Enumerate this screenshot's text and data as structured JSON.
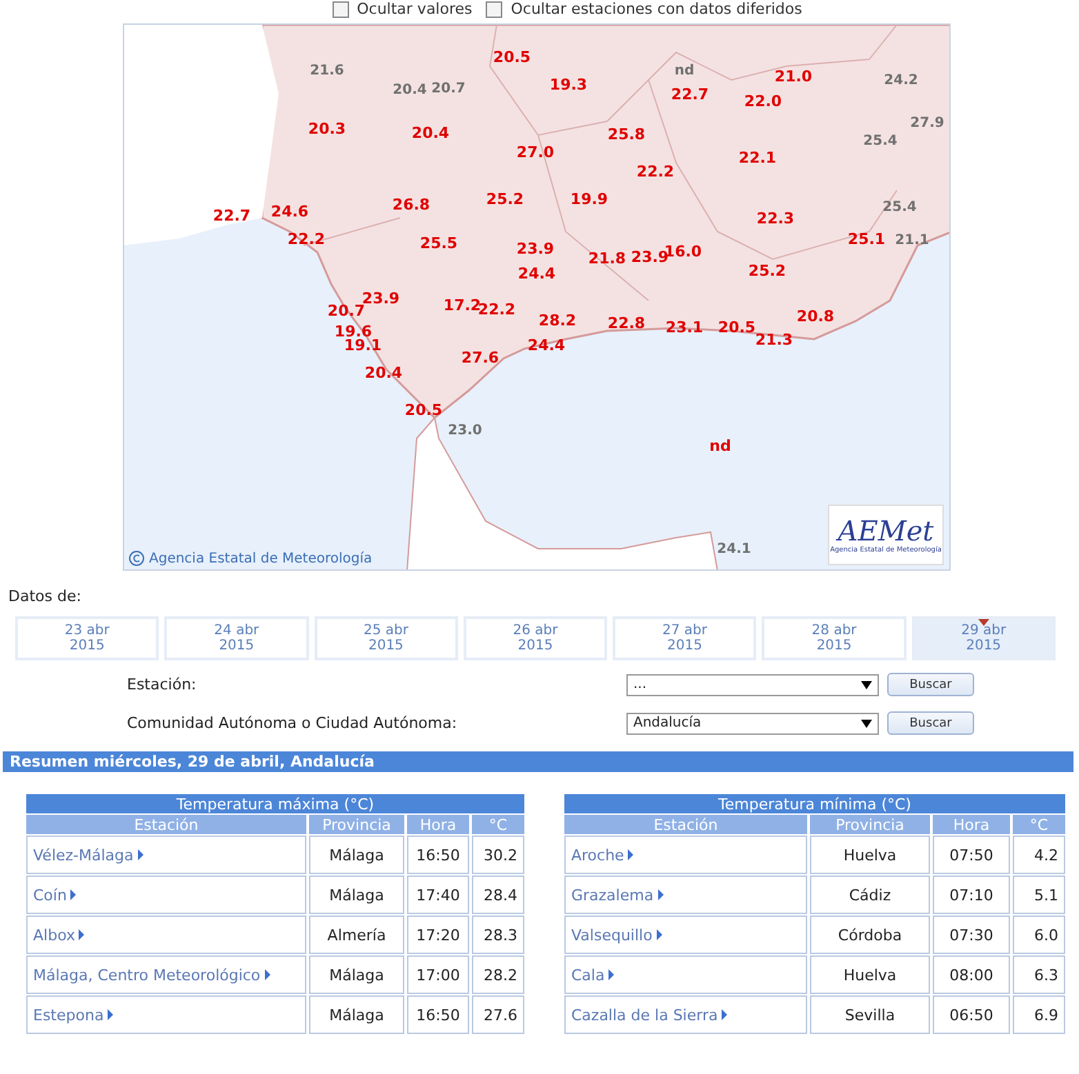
{
  "options": [
    {
      "label": "Ocultar valores",
      "checked": false
    },
    {
      "label": "Ocultar estaciones con datos diferidos",
      "checked": false
    }
  ],
  "map": {
    "labels": [
      {
        "text": "21.6",
        "kind": "other"
      },
      {
        "text": "20.4",
        "kind": "other"
      },
      {
        "text": "20.7",
        "kind": "other"
      },
      {
        "text": "nd",
        "kind": "other"
      },
      {
        "text": "24.2",
        "kind": "other"
      },
      {
        "text": "27.9",
        "kind": "other"
      },
      {
        "text": "25.4",
        "kind": "other"
      },
      {
        "text": "25.4",
        "kind": "other"
      },
      {
        "text": "21.1",
        "kind": "other"
      },
      {
        "text": "23.0",
        "kind": "other"
      },
      {
        "text": "24.1",
        "kind": "other"
      },
      {
        "text": "20.5",
        "kind": "region"
      },
      {
        "text": "19.3",
        "kind": "region"
      },
      {
        "text": "22.7",
        "kind": "region"
      },
      {
        "text": "21.0",
        "kind": "region"
      },
      {
        "text": "22.0",
        "kind": "region"
      },
      {
        "text": "20.3",
        "kind": "region"
      },
      {
        "text": "20.4",
        "kind": "region"
      },
      {
        "text": "27.0",
        "kind": "region"
      },
      {
        "text": "25.8",
        "kind": "region"
      },
      {
        "text": "22.2",
        "kind": "region"
      },
      {
        "text": "22.1",
        "kind": "region"
      },
      {
        "text": "22.7",
        "kind": "region"
      },
      {
        "text": "24.6",
        "kind": "region"
      },
      {
        "text": "25.2",
        "kind": "region"
      },
      {
        "text": "19.9",
        "kind": "region"
      },
      {
        "text": "26.8",
        "kind": "region"
      },
      {
        "text": "22.2",
        "kind": "region"
      },
      {
        "text": "22.3",
        "kind": "region"
      },
      {
        "text": "25.5",
        "kind": "region"
      },
      {
        "text": "23.9",
        "kind": "region"
      },
      {
        "text": "21.8",
        "kind": "region"
      },
      {
        "text": "23.9",
        "kind": "region"
      },
      {
        "text": "16.0",
        "kind": "region"
      },
      {
        "text": "25.1",
        "kind": "region"
      },
      {
        "text": "24.4",
        "kind": "region"
      },
      {
        "text": "25.2",
        "kind": "region"
      },
      {
        "text": "20.7",
        "kind": "region"
      },
      {
        "text": "23.9",
        "kind": "region"
      },
      {
        "text": "17.2",
        "kind": "region"
      },
      {
        "text": "22.2",
        "kind": "region"
      },
      {
        "text": "22.8",
        "kind": "region"
      },
      {
        "text": "23.1",
        "kind": "region"
      },
      {
        "text": "20.5",
        "kind": "region"
      },
      {
        "text": "20.8",
        "kind": "region"
      },
      {
        "text": "21.3",
        "kind": "region"
      },
      {
        "text": "19.6",
        "kind": "region"
      },
      {
        "text": "19.1",
        "kind": "region"
      },
      {
        "text": "27.6",
        "kind": "region"
      },
      {
        "text": "24.4",
        "kind": "region"
      },
      {
        "text": "28.2",
        "kind": "region"
      },
      {
        "text": "20.4",
        "kind": "region"
      },
      {
        "text": "20.5",
        "kind": "region"
      },
      {
        "text": "nd",
        "kind": "region"
      }
    ],
    "attribution": "Agencia Estatal de Meteorología",
    "logo": {
      "mark": "AEMet",
      "caption": "Agencia Estatal de Meteorología"
    }
  },
  "dates_label": "Datos de:",
  "dates": [
    {
      "day": "23 abr",
      "year": "2015",
      "selected": false
    },
    {
      "day": "24 abr",
      "year": "2015",
      "selected": false
    },
    {
      "day": "25 abr",
      "year": "2015",
      "selected": false
    },
    {
      "day": "26 abr",
      "year": "2015",
      "selected": false
    },
    {
      "day": "27 abr",
      "year": "2015",
      "selected": false
    },
    {
      "day": "28 abr",
      "year": "2015",
      "selected": false
    },
    {
      "day": "29 abr",
      "year": "2015",
      "selected": true
    }
  ],
  "filters": [
    {
      "label": "Estación:",
      "value": "...",
      "button": "Buscar"
    },
    {
      "label": "Comunidad Autónoma o Ciudad Autónoma:",
      "value": "Andalucía",
      "button": "Buscar"
    }
  ],
  "summary_title": "Resumen miércoles, 29 de abril, Andalucía",
  "tables": [
    {
      "title": "Temperatura máxima (°C)",
      "columns": [
        "Estación",
        "Provincia",
        "Hora",
        "°C"
      ],
      "rows": [
        [
          "Vélez-Málaga",
          "Málaga",
          "16:50",
          "30.2"
        ],
        [
          "Coín",
          "Málaga",
          "17:40",
          "28.4"
        ],
        [
          "Albox",
          "Almería",
          "17:20",
          "28.3"
        ],
        [
          "Málaga, Centro Meteorológico",
          "Málaga",
          "17:00",
          "28.2"
        ],
        [
          "Estepona",
          "Málaga",
          "16:50",
          "27.6"
        ]
      ]
    },
    {
      "title": "Temperatura mínima (°C)",
      "columns": [
        "Estación",
        "Provincia",
        "Hora",
        "°C"
      ],
      "rows": [
        [
          "Aroche",
          "Huelva",
          "07:50",
          "4.2"
        ],
        [
          "Grazalema",
          "Cádiz",
          "07:10",
          "5.1"
        ],
        [
          "Valsequillo",
          "Córdoba",
          "07:30",
          "6.0"
        ],
        [
          "Cala",
          "Huelva",
          "08:00",
          "6.3"
        ],
        [
          "Cazalla de la Sierra",
          "Sevilla",
          "06:50",
          "6.9"
        ]
      ]
    }
  ]
}
